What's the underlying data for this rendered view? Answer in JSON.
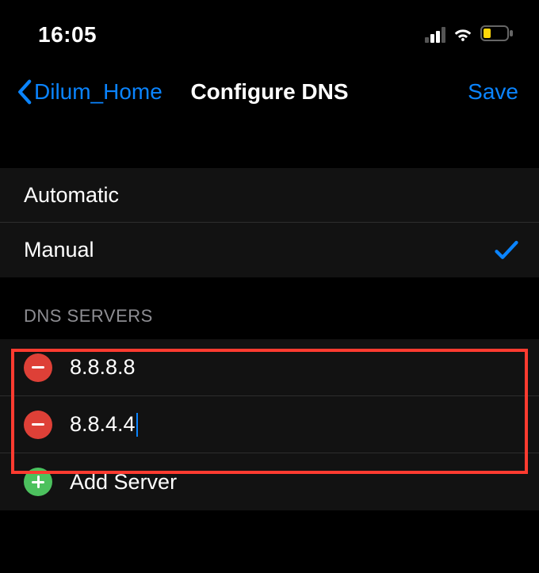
{
  "statusbar": {
    "time": "16:05"
  },
  "nav": {
    "back_label": "Dilum_Home",
    "title": "Configure DNS",
    "save_label": "Save"
  },
  "modes": {
    "automatic": "Automatic",
    "manual": "Manual"
  },
  "sections": {
    "dns_header": "DNS SERVERS"
  },
  "servers": {
    "s0": "8.8.8.8",
    "s1": "8.8.4.4",
    "add_label": "Add Server"
  }
}
